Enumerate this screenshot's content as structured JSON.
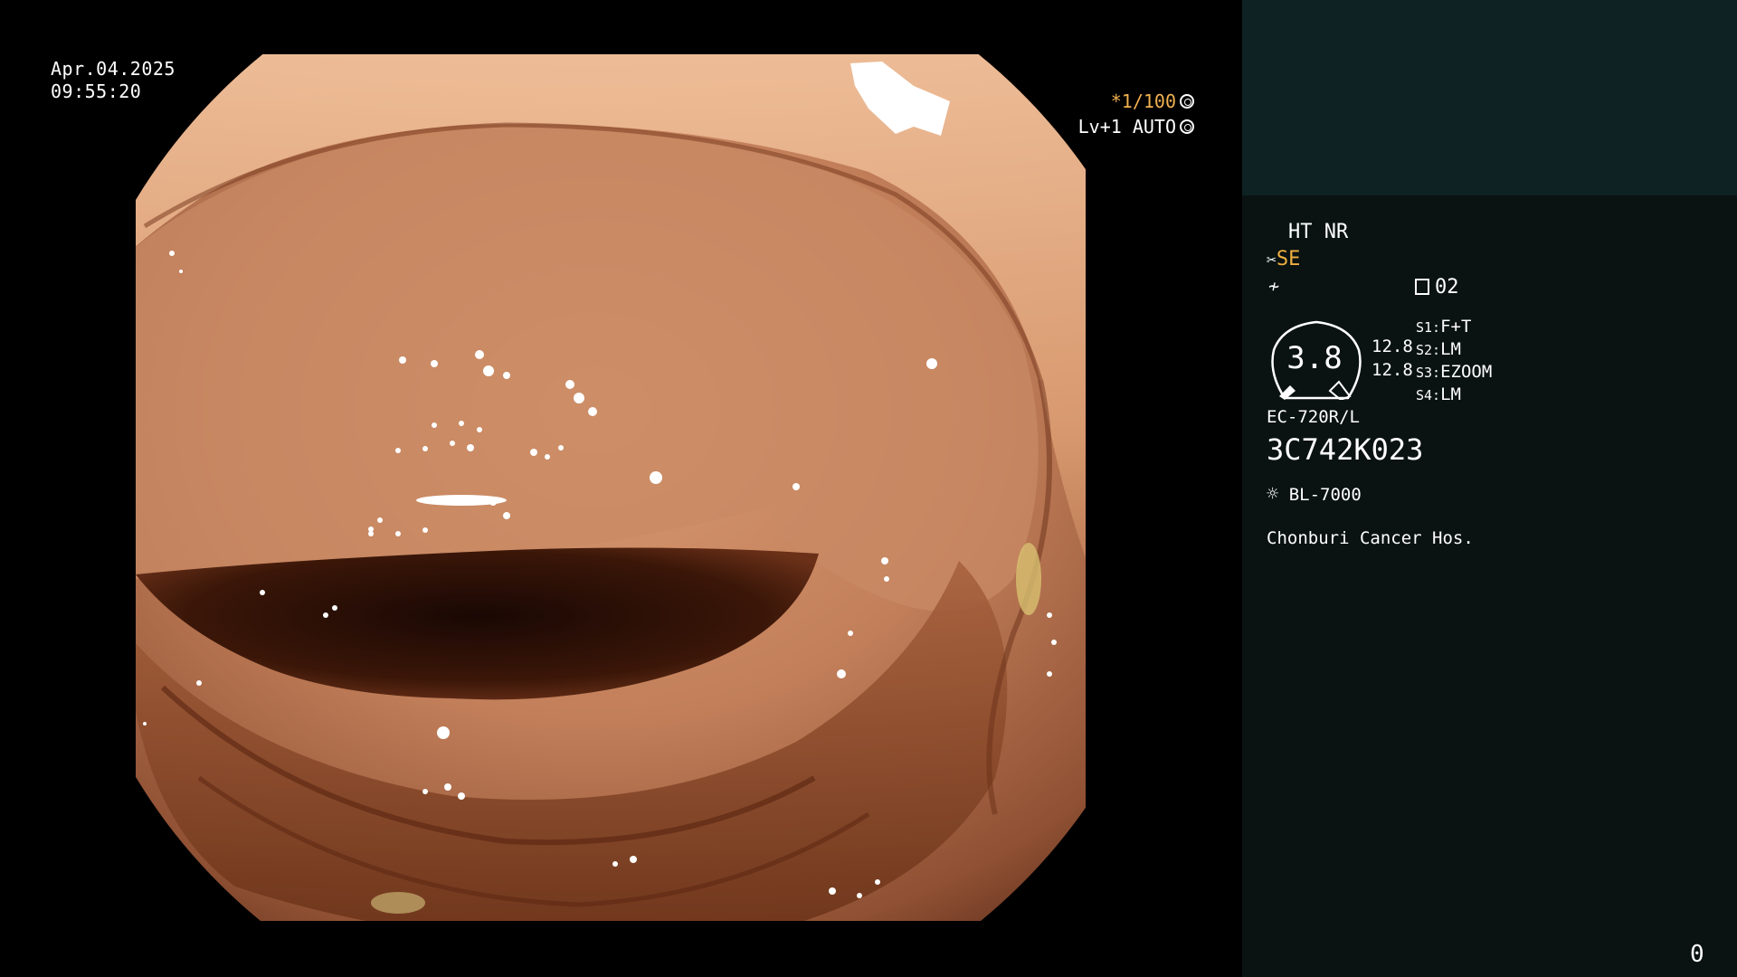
{
  "overlay": {
    "date": "Apr.04.2025",
    "time": "09:55:20",
    "shutter": "*1/100",
    "level": "Lv+1 AUTO"
  },
  "panel": {
    "ht_nr": "HT NR",
    "se": "SE",
    "record_num": "02",
    "gauge_value": "3.8",
    "gauge_side_1": "12.8",
    "gauge_side_2": "12.8",
    "s1_label": "S1:",
    "s1_value": "F+T",
    "s2_label": "S2:",
    "s2_value": "LM",
    "s3_label": "S3:",
    "s3_value": "EZOOM",
    "s4_label": "S4:",
    "s4_value": "LM",
    "scope_model": "EC-720R/L",
    "serial": "3C742K023",
    "light_source": "BL-7000",
    "hospital": "Chonburi Cancer Hos.",
    "counter": "0"
  },
  "colors": {
    "panel_bg": "#0a1212",
    "panel_top": "#0e2224",
    "accent_yellow": "#f0b040"
  },
  "icons": [
    "shutter-icon",
    "auto-iris-icon",
    "scissor-icon",
    "filter-icon",
    "record-icon",
    "light-icon"
  ]
}
